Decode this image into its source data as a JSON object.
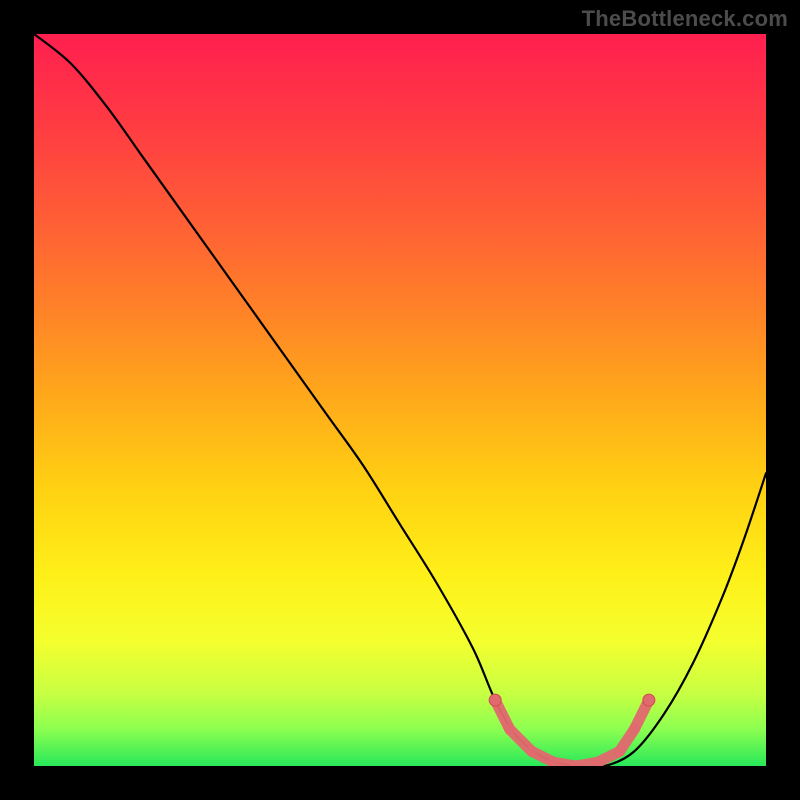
{
  "watermark": "TheBottleneck.com",
  "colors": {
    "bg": "#000000",
    "watermark": "#4c4c4c",
    "curve": "#000000",
    "markers_fill": "#e16a6e",
    "markers_stroke": "#d24a50",
    "gradient_stops": [
      {
        "offset": 0.0,
        "color": "#ff1f4f"
      },
      {
        "offset": 0.12,
        "color": "#ff3a43"
      },
      {
        "offset": 0.25,
        "color": "#ff5d36"
      },
      {
        "offset": 0.38,
        "color": "#ff8327"
      },
      {
        "offset": 0.5,
        "color": "#ffaa1a"
      },
      {
        "offset": 0.62,
        "color": "#ffd112"
      },
      {
        "offset": 0.74,
        "color": "#fff019"
      },
      {
        "offset": 0.83,
        "color": "#f4ff2e"
      },
      {
        "offset": 0.9,
        "color": "#c8ff42"
      },
      {
        "offset": 0.95,
        "color": "#8cff50"
      },
      {
        "offset": 1.0,
        "color": "#28e85a"
      }
    ]
  },
  "chart_data": {
    "type": "line",
    "title": "",
    "xlabel": "",
    "ylabel": "",
    "xlim": [
      0,
      100
    ],
    "ylim": [
      0,
      100
    ],
    "series": [
      {
        "name": "bottleneck-curve",
        "x": [
          0,
          5,
          10,
          15,
          20,
          25,
          30,
          35,
          40,
          45,
          50,
          55,
          60,
          63,
          66,
          70,
          74,
          78,
          82,
          86,
          90,
          94,
          97,
          100
        ],
        "y": [
          100,
          96,
          90,
          83,
          76,
          69,
          62,
          55,
          48,
          41,
          33,
          25,
          16,
          9,
          4,
          1,
          0,
          0,
          2,
          7,
          14,
          23,
          31,
          40
        ]
      }
    ],
    "markers": {
      "name": "bottleneck-range",
      "points": [
        {
          "x": 63,
          "y": 9
        },
        {
          "x": 65,
          "y": 5
        },
        {
          "x": 68,
          "y": 2
        },
        {
          "x": 71,
          "y": 0.5
        },
        {
          "x": 74,
          "y": 0
        },
        {
          "x": 77,
          "y": 0.5
        },
        {
          "x": 80,
          "y": 2
        },
        {
          "x": 82,
          "y": 5
        },
        {
          "x": 84,
          "y": 9
        }
      ]
    }
  }
}
